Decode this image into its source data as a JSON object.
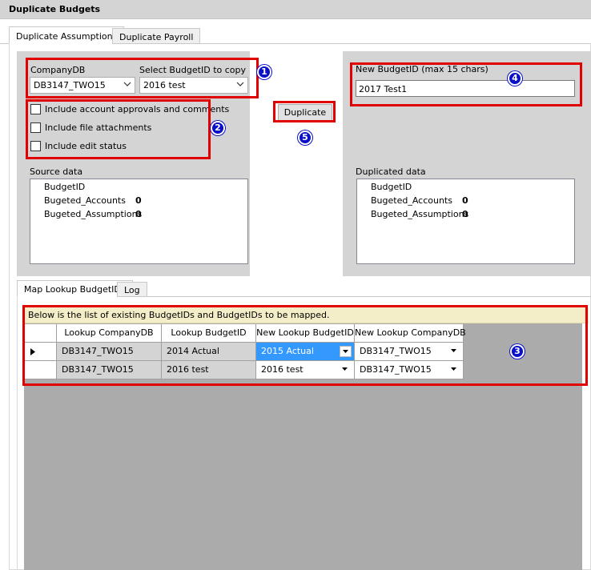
{
  "window": {
    "title": "Duplicate Budgets"
  },
  "tabs": [
    {
      "label": "Duplicate Assumptions",
      "active": true
    },
    {
      "label": "Duplicate Payroll",
      "active": false
    }
  ],
  "source": {
    "company_label": "CompanyDB",
    "company_value": "DB3147_TWO15",
    "budget_label": "Select BudgetID to copy",
    "budget_value": "2016 test",
    "options": [
      {
        "label": "Include account approvals and comments",
        "checked": false
      },
      {
        "label": "Include file attachments",
        "checked": false
      },
      {
        "label": "Include edit status",
        "checked": false
      }
    ],
    "data_label": "Source data",
    "rows": [
      {
        "name": "BudgetID",
        "value": ""
      },
      {
        "name": "Bugeted_Accounts",
        "value": "0"
      },
      {
        "name": "Bugeted_Assumptions",
        "value": "0"
      }
    ]
  },
  "duplicate_button": "Duplicate",
  "target": {
    "new_id_label": "New BudgetID (max 15 chars)",
    "new_id_value": "2017 Test1",
    "data_label": "Duplicated data",
    "rows": [
      {
        "name": "BudgetID",
        "value": ""
      },
      {
        "name": "Bugeted_Accounts",
        "value": "0"
      },
      {
        "name": "Bugeted_Assumptions",
        "value": "0"
      }
    ]
  },
  "lower_tabs": [
    {
      "label": "Map Lookup BudgetIDs",
      "active": true
    },
    {
      "label": "Log",
      "active": false
    }
  ],
  "lookup": {
    "info": "Below is the list of existing BudgetIDs and BudgetIDs to be mapped.",
    "columns": [
      "Lookup CompanyDB",
      "Lookup BudgetID",
      "New Lookup BudgetID",
      "New Lookup CompanyDB"
    ],
    "rows": [
      {
        "company": "DB3147_TWO15",
        "budget": "2014 Actual",
        "new_budget": "2015 Actual",
        "new_company": "DB3147_TWO15",
        "current": true
      },
      {
        "company": "DB3147_TWO15",
        "budget": "2016 test",
        "new_budget": "2016 test",
        "new_company": "DB3147_TWO15",
        "current": false
      }
    ]
  },
  "badges": [
    "1",
    "2",
    "3",
    "4",
    "5"
  ],
  "colors": {
    "annotation_red": "#e00000",
    "badge_blue": "#0a10c8",
    "selection_blue": "#3399ff",
    "info_yellow": "#f4eec8"
  }
}
